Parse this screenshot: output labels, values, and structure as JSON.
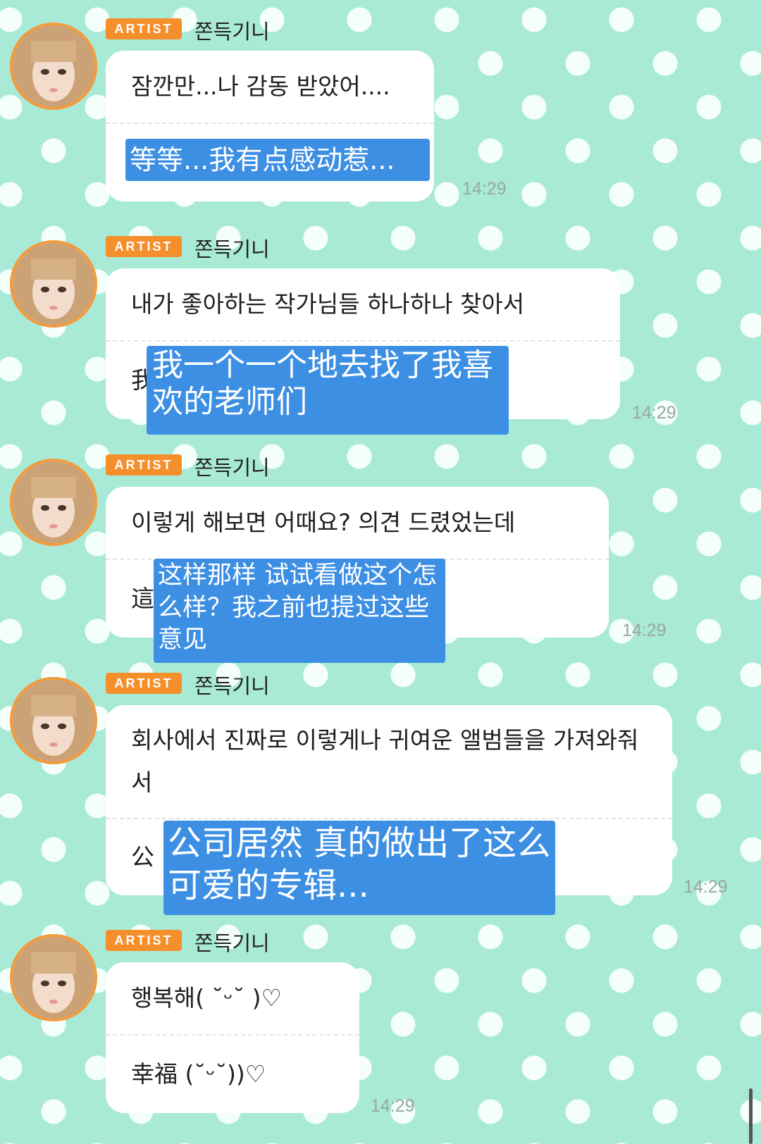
{
  "messages": [
    {
      "badge": "ARTIST",
      "sender": "쫀득기니",
      "original": "잠깐만...나 감동 받았어....",
      "translation": "",
      "overlay": "等等...我有点感动惹...",
      "time": "14:29"
    },
    {
      "badge": "ARTIST",
      "sender": "쫀득기니",
      "original": "내가 좋아하는 작가님들 하나하나 찾아서",
      "translation": "我",
      "overlay": "我一个一个地去找了我喜欢的老师们",
      "time": "14:29"
    },
    {
      "badge": "ARTIST",
      "sender": "쫀득기니",
      "original": "이렇게 해보면 어때요? 의견 드렸었는데",
      "translation": "這",
      "overlay": "这样那样 试试看做这个怎么样？我之前也提过这些意见",
      "time": "14:29"
    },
    {
      "badge": "ARTIST",
      "sender": "쫀득기니",
      "original": "회사에서 진짜로 이렇게나 귀여운 앨범들을 가져와줘서",
      "translation": "公",
      "overlay": "公司居然 真的做出了这么可爱的专辑...",
      "time": "14:29"
    },
    {
      "badge": "ARTIST",
      "sender": "쫀득기니",
      "original": "행복해( ˘ᵕ˘ )♡",
      "translation": "幸福 (˘ᵕ˘))♡",
      "overlay": "",
      "time": "14:29"
    }
  ],
  "colors": {
    "background": "#a8ead6",
    "badge": "#f58f2c",
    "avatar_ring": "#f39a3c",
    "overlay": "#3d8fe4"
  }
}
